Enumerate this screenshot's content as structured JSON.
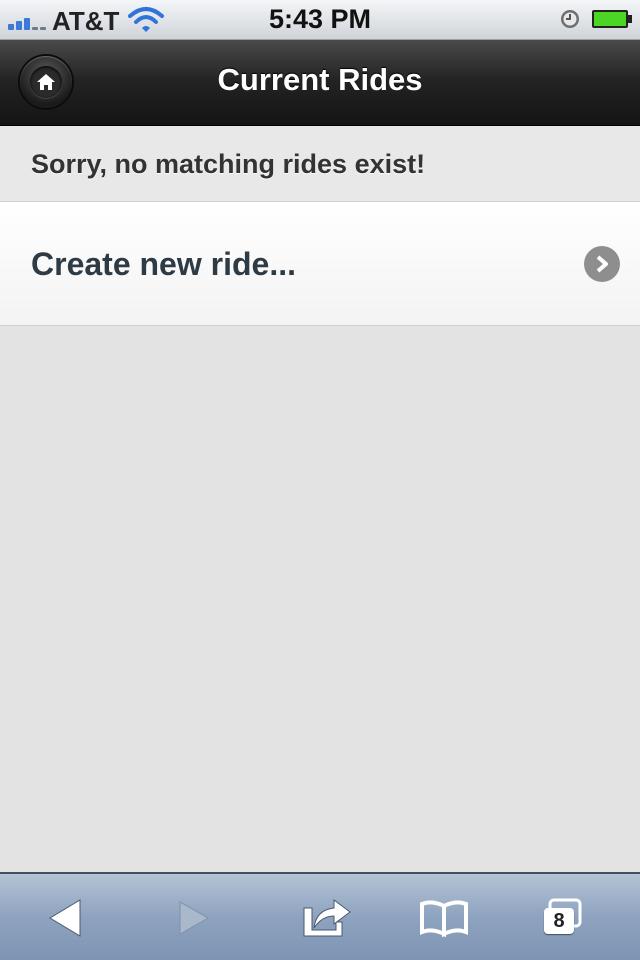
{
  "status_bar": {
    "carrier": "AT&T",
    "time": "5:43 PM",
    "signal_icon": "signal-bars-icon",
    "wifi_icon": "wifi-icon",
    "clock_icon": "alarm-clock-icon",
    "battery_icon": "battery-icon",
    "battery_level": 1.0,
    "battery_color": "#4cd624",
    "signal_color": "#3b7ad6"
  },
  "header": {
    "title": "Current Rides",
    "home_icon": "home-icon"
  },
  "content": {
    "empty_message": "Sorry, no matching rides exist!",
    "create_label": "Create new ride...",
    "create_icon": "chevron-right-icon"
  },
  "toolbar": {
    "back_icon": "back-arrow-icon",
    "forward_icon": "forward-arrow-icon",
    "share_icon": "share-icon",
    "bookmarks_icon": "bookmarks-icon",
    "tabs_icon": "tabs-icon",
    "tabs_count": "8"
  }
}
